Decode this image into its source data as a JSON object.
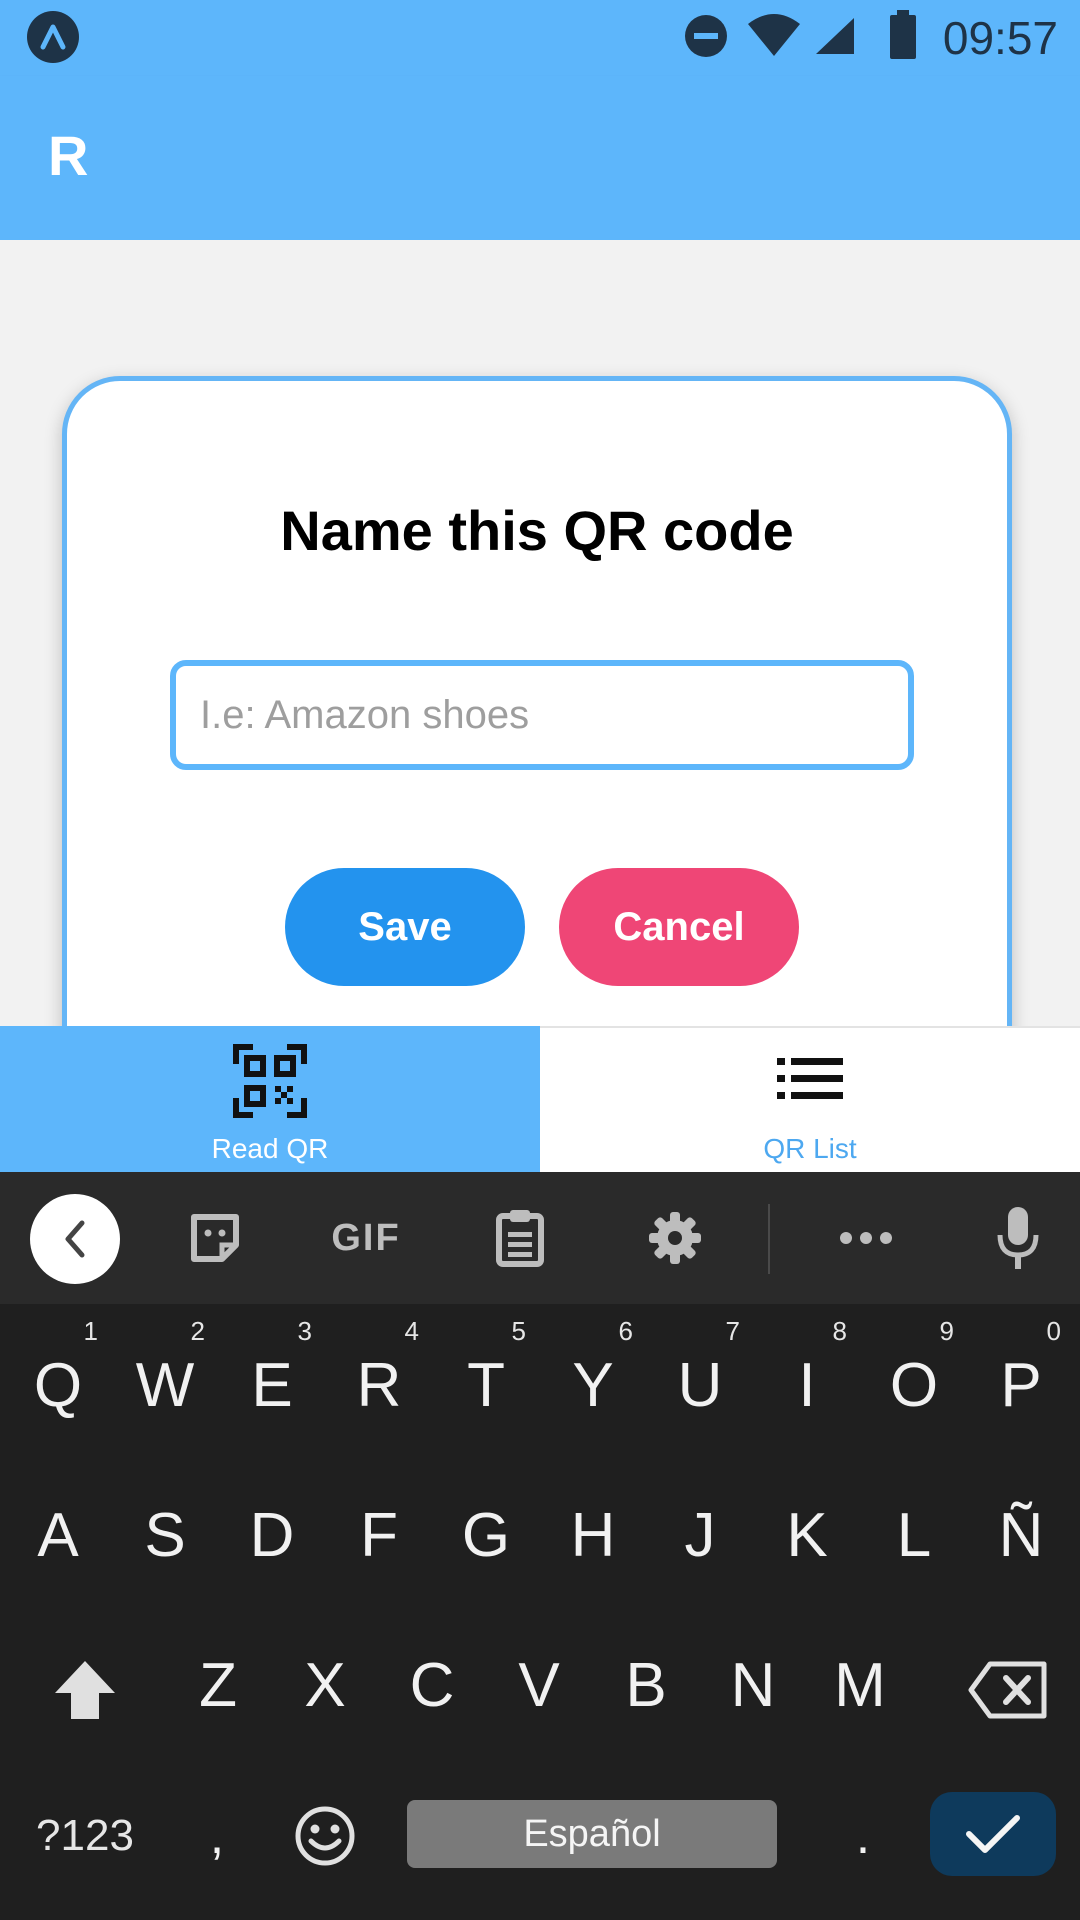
{
  "status_bar": {
    "time": "09:57"
  },
  "header": {
    "title": "R"
  },
  "dialog": {
    "title": "Name this QR code",
    "input_value": "",
    "input_placeholder": "I.e: Amazon shoes",
    "save_label": "Save",
    "cancel_label": "Cancel"
  },
  "tabs": [
    {
      "label": "Read QR",
      "icon": "qr-code-icon",
      "active": true
    },
    {
      "label": "QR List",
      "icon": "list-icon",
      "active": false
    }
  ],
  "keyboard": {
    "toolbar": {
      "gif_label": "GIF"
    },
    "row1": [
      "Q",
      "W",
      "E",
      "R",
      "T",
      "Y",
      "U",
      "I",
      "O",
      "P"
    ],
    "row1_hints": [
      "1",
      "2",
      "3",
      "4",
      "5",
      "6",
      "7",
      "8",
      "9",
      "0"
    ],
    "row2": [
      "A",
      "S",
      "D",
      "F",
      "G",
      "H",
      "J",
      "K",
      "L",
      "Ñ"
    ],
    "row3": [
      "Z",
      "X",
      "C",
      "V",
      "B",
      "N",
      "M"
    ],
    "symbols_label": "?123",
    "comma_label": ",",
    "space_label": "Español",
    "period_label": "."
  },
  "colors": {
    "header": "#5db6fb",
    "save": "#2393ee",
    "cancel": "#ef4676",
    "keyboard_bg": "#1f1f1f",
    "enter_key": "#0e3a5c"
  }
}
